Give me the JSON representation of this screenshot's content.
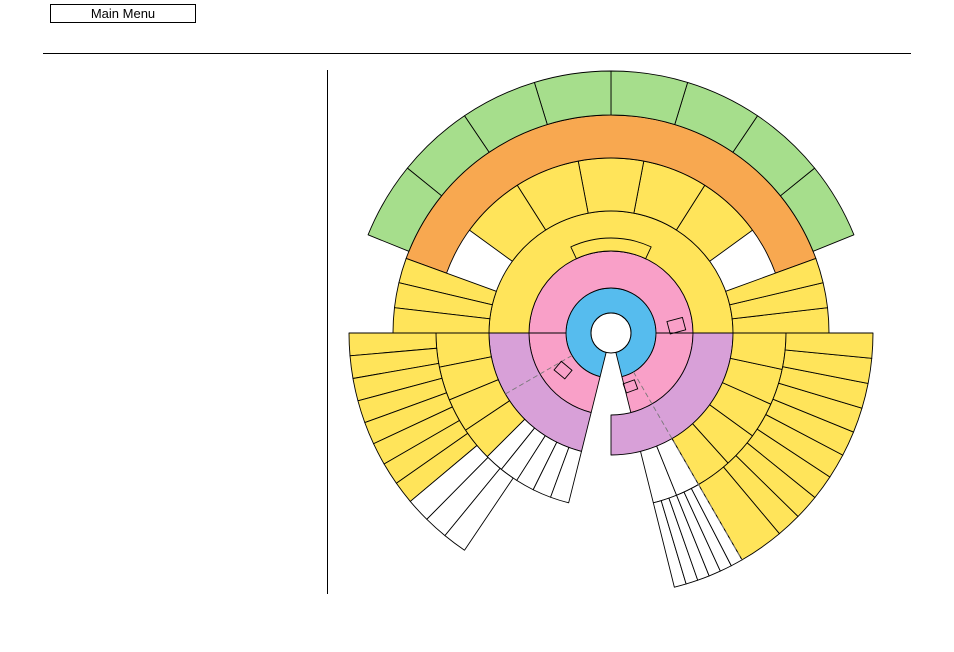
{
  "header": {
    "main_menu_label": "Main Menu"
  },
  "colors": {
    "center": "#ffffff",
    "blue": "#56bcee",
    "pink": "#f9a0c8",
    "purple": "#d8a0d8",
    "yellow": "#ffe45a",
    "orange": "#f8a850",
    "green": "#a6de8c",
    "white": "#ffffff",
    "stroke": "#000000"
  }
}
